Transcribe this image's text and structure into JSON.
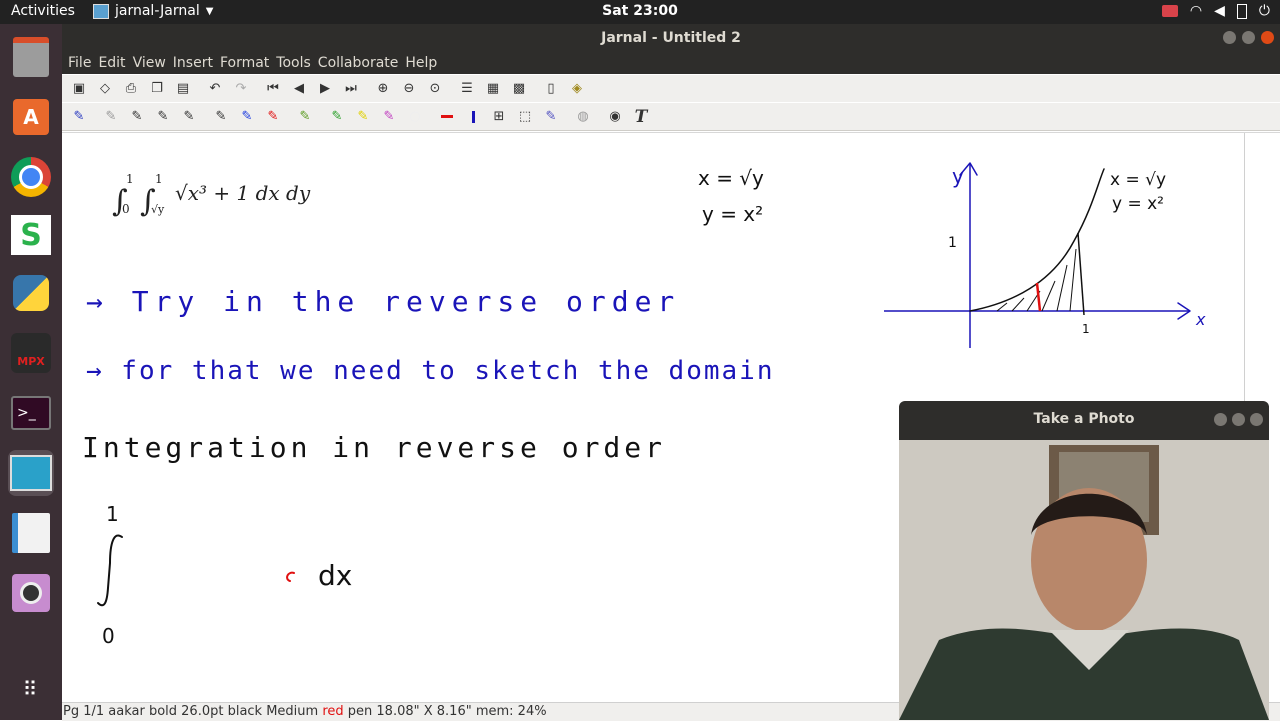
{
  "topbar": {
    "activities": "Activities",
    "app_name": "jarnal-Jarnal",
    "clock": "Sat 23:00",
    "tray_icons": [
      "camera-icon",
      "wifi-icon",
      "volume-icon",
      "battery-icon",
      "power-icon"
    ]
  },
  "dock": {
    "items": [
      "files-icon",
      "software-icon",
      "chrome-icon",
      "sigil-icon",
      "python-icon",
      "mpx-icon",
      "terminal-icon",
      "jarnal-icon",
      "libreoffice-icon",
      "cheese-icon",
      "apps-grid-icon"
    ],
    "mpx_label": "MPX"
  },
  "window": {
    "title": "Jarnal - Untitled 2",
    "menu": [
      "File",
      "Edit",
      "View",
      "Insert",
      "Format",
      "Tools",
      "Collaborate",
      "Help"
    ]
  },
  "toolbar1": [
    "save-icon",
    "eraser-icon",
    "print-icon",
    "copy-icon",
    "paste-icon",
    "undo-icon",
    "redo-icon",
    "first-page-icon",
    "prev-page-icon",
    "next-page-icon",
    "last-page-icon",
    "zoom-in-icon",
    "zoom-out-icon",
    "zoom-fit-icon",
    "layout-icon",
    "grid-icon",
    "stack-icon",
    "page-icon",
    "lock-icon"
  ],
  "toolbar2": [
    "pen-icon",
    "pencil-icon",
    "pen-black-icon",
    "pen-black2-icon",
    "pen-black3-icon",
    "pen-black4-icon",
    "pen-blue-icon",
    "pen-red-icon",
    "pen-multi-icon",
    "highlight-green-icon",
    "highlight-yellow-icon",
    "highlight-pink-icon",
    "blank-icon",
    "line-red-icon",
    "line-blue-icon",
    "select-icon",
    "select-region-icon",
    "pen-custom-icon",
    "shape-icon",
    "globe-icon",
    "text-icon"
  ],
  "text_tool_glyph": "T",
  "canvas": {
    "formula_int": "∫",
    "formula_lower1": "0",
    "formula_upper": "1",
    "formula_lower2": "√y",
    "formula_body": "√x³ + 1 dx dy",
    "eq1": "x = √y",
    "eq2": "y = x²",
    "line1": "→ Try in the reverse order",
    "line2": "→ for that we need to sketch the domain",
    "heading": "Integration in reverse order",
    "int_upper": "1",
    "int_lower": "0",
    "int_dx": "dx",
    "graph_y": "y",
    "graph_x": "x",
    "graph_one_y": "1",
    "graph_one_x": "1",
    "graph_eq1": "x = √y",
    "graph_eq2": "y = x²"
  },
  "status": {
    "part1": "Pg 1/1 aakar bold 26.0pt black  Medium ",
    "part_red": "red",
    "part2": " pen  18.08\" X 8.16\"  mem: 24%"
  },
  "photo": {
    "title": "Take a Photo"
  },
  "colors": {
    "ink_blue": "#1a14b8",
    "ink_black": "#111111",
    "ink_red": "#e01010",
    "topbar": "#222222",
    "dock": "#3b2f35"
  }
}
